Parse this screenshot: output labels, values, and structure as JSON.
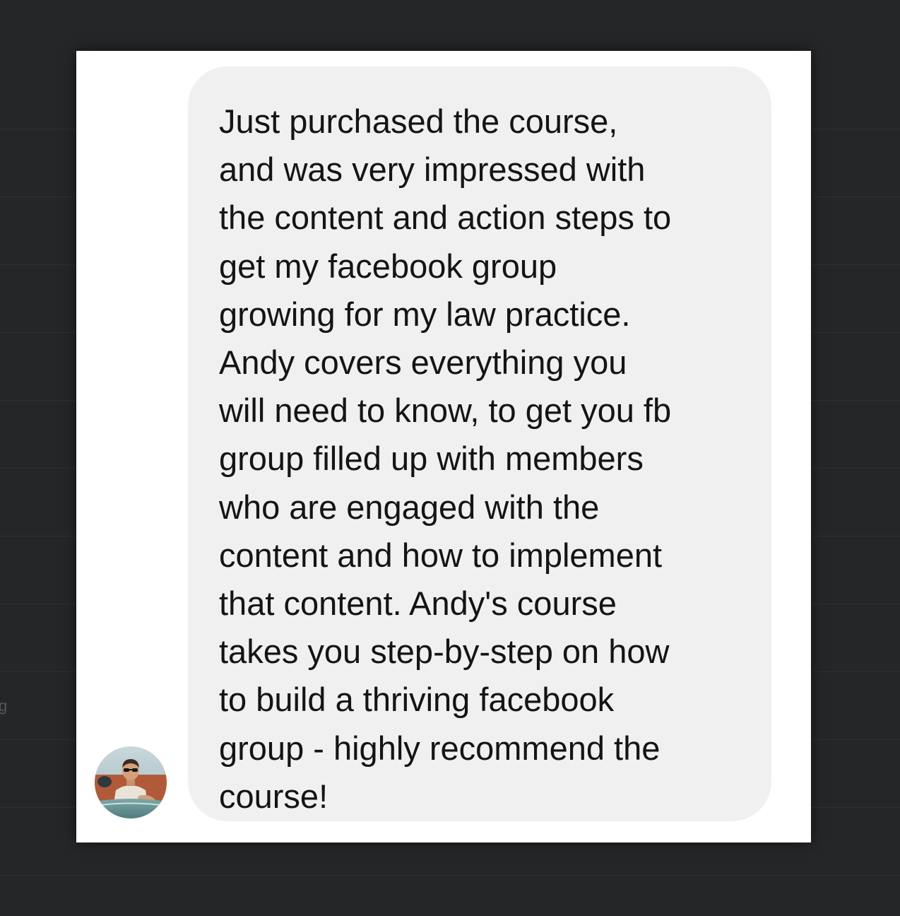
{
  "background": {
    "color": "#252628",
    "stray_glyph": "g"
  },
  "card": {
    "background": "#ffffff"
  },
  "sender": {
    "avatar_icon": "profile-photo-man-in-convertible"
  },
  "message": {
    "bubble_color": "#f0f0f0",
    "text": "Just purchased the course,\nand was very impressed with\nthe content and action steps to\nget my facebook group\ngrowing for my law practice.\nAndy covers everything you\nwill need to know, to get you fb\ngroup filled up with members\nwho are engaged with the\ncontent and how to implement\nthat content. Andy's course\ntakes you step-by-step on how\nto build a thriving facebook\ngroup - highly recommend the\ncourse!"
  }
}
